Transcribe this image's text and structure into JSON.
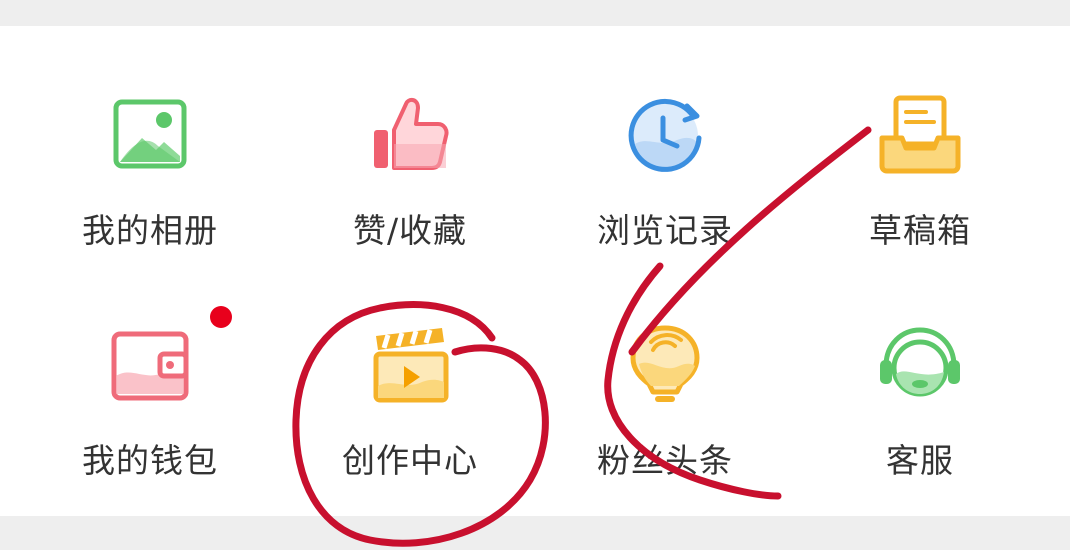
{
  "menu": {
    "items": [
      {
        "label": "我的相册",
        "icon": "photo-album-icon",
        "color": "#5cc76a"
      },
      {
        "label": "赞/收藏",
        "icon": "thumbs-up-icon",
        "color": "#f06070"
      },
      {
        "label": "浏览记录",
        "icon": "history-clock-icon",
        "color": "#3b8fe0"
      },
      {
        "label": "草稿箱",
        "icon": "draft-tray-icon",
        "color": "#f5b228"
      },
      {
        "label": "我的钱包",
        "icon": "wallet-icon",
        "color": "#ef6b7a",
        "badge": "dot"
      },
      {
        "label": "创作中心",
        "icon": "clapperboard-video-icon",
        "color": "#f5b228"
      },
      {
        "label": "粉丝头条",
        "icon": "lightbulb-icon",
        "color": "#f5b228"
      },
      {
        "label": "客服",
        "icon": "headset-icon",
        "color": "#5cc76a"
      }
    ]
  },
  "colors": {
    "badge": "#e8001c",
    "annotation_ink": "#c8102e",
    "label_text": "#333333"
  }
}
